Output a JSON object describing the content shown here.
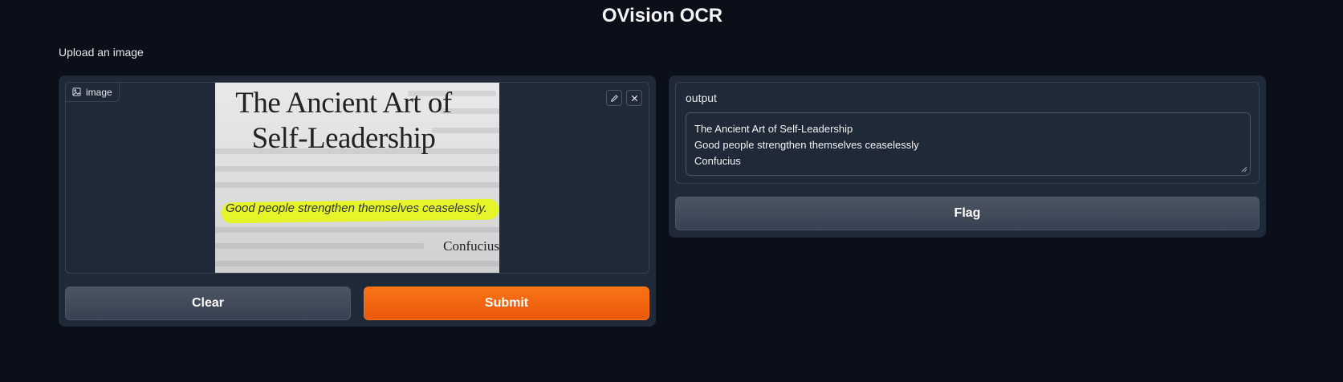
{
  "app": {
    "title": "OVision OCR",
    "description": "Upload an image"
  },
  "input": {
    "label": "image",
    "image_title": "The Ancient Art of Self-Leadership",
    "image_title_line1": "The Ancient Art of",
    "image_title_line2": "Self-Leadership",
    "image_quote": "Good people strengthen themselves ceaselessly.",
    "image_author": "Confucius"
  },
  "buttons": {
    "clear": "Clear",
    "submit": "Submit",
    "flag": "Flag"
  },
  "output": {
    "label": "output",
    "lines": [
      "The Ancient Art of Self-Leadership",
      "Good people strengthen themselves ceaselessly",
      "Confucius"
    ]
  },
  "colors": {
    "background": "#0b0f19",
    "panel": "#1f2937",
    "accent": "#f97316",
    "highlight": "#e6f52a"
  }
}
